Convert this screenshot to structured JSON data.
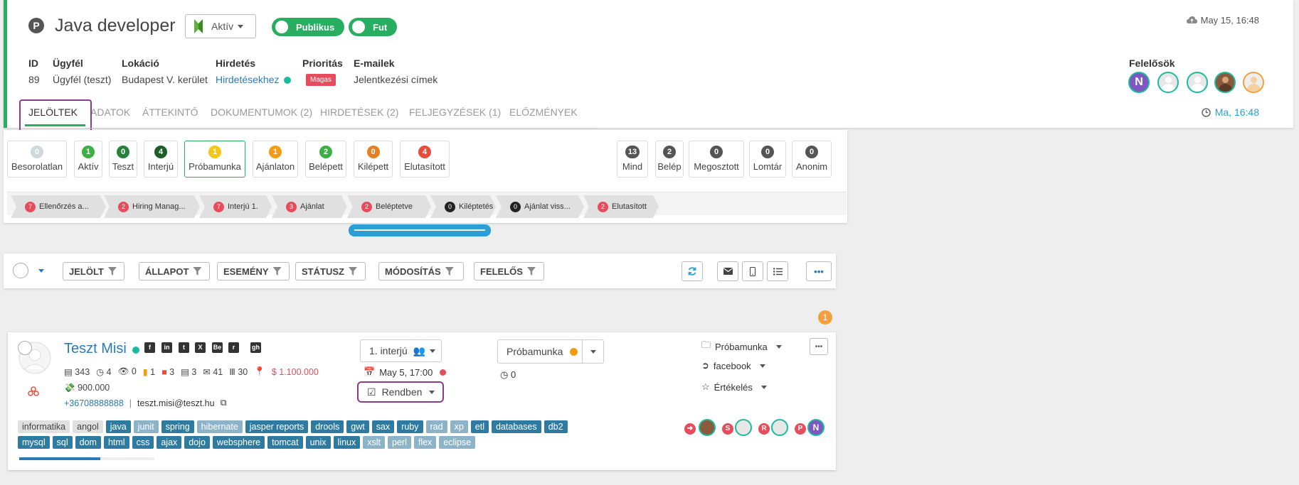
{
  "header": {
    "badge": "P",
    "title": "Java developer",
    "status": "Aktív",
    "toggle_public": "Publikus",
    "toggle_running": "Fut",
    "sync_time": "May 15, 16:48",
    "meta": {
      "id_label": "ID",
      "id_value": "89",
      "client_label": "Ügyfél",
      "client_value": "Ügyfél (teszt)",
      "location_label": "Lokáció",
      "location_value": "Budapest V. kerület",
      "ad_label": "Hirdetés",
      "ad_value": "Hirdetésekhez",
      "priority_label": "Prioritás",
      "priority_value": "Magas",
      "email_label": "E-mailek",
      "email_value": "Jelentkezési címek"
    },
    "responsibles_label": "Felelősök",
    "tabs": [
      "JELÖLTEK",
      "ADATOK",
      "ÁTTEKINTŐ",
      "DOKUMENTUMOK (2)",
      "HIRDETÉSEK (2)",
      "FELJEGYZÉSEK (1)",
      "ELŐZMÉNYEK"
    ],
    "last_time": "Ma, 16:48"
  },
  "status_counts": [
    {
      "label": "Besorolatlan",
      "count": "0",
      "color": "#cfd8dc"
    },
    {
      "label": "Aktív",
      "count": "1",
      "color": "#3cb043"
    },
    {
      "label": "Teszt",
      "count": "0",
      "color": "#27813a"
    },
    {
      "label": "Interjú",
      "count": "4",
      "color": "#1e5e2a"
    },
    {
      "label": "Próbamunka",
      "count": "1",
      "color": "#f5c518"
    },
    {
      "label": "Ajánlaton",
      "count": "1",
      "color": "#f39c12"
    },
    {
      "label": "Belépett",
      "count": "2",
      "color": "#3cb043"
    },
    {
      "label": "Kilépett",
      "count": "0",
      "color": "#e67e22"
    },
    {
      "label": "Elutasított",
      "count": "4",
      "color": "#e74c3c"
    }
  ],
  "status_counts_right": [
    {
      "label": "Mind",
      "count": "13"
    },
    {
      "label": "Belép",
      "count": "2"
    },
    {
      "label": "Megosztott",
      "count": "0"
    },
    {
      "label": "Lomtár",
      "count": "0"
    },
    {
      "label": "Anonim",
      "count": "0"
    }
  ],
  "pipeline": [
    {
      "count": "7",
      "label": "Ellenőrzés a..."
    },
    {
      "count": "2",
      "label": "Hiring Manag..."
    },
    {
      "count": "7",
      "label": "Interjú 1."
    },
    {
      "count": "3",
      "label": "Ajánlat"
    },
    {
      "count": "2",
      "label": "Beléptetve"
    },
    {
      "count": "0",
      "label": "Kiléptetés"
    },
    {
      "count": "0",
      "label": "Ajánlat viss..."
    },
    {
      "count": "2",
      "label": "Elutasított"
    }
  ],
  "filters": [
    "JELÖLT",
    "ÁLLAPOT",
    "ESEMÉNY",
    "STÁTUSZ",
    "MÓDOSÍTÁS",
    "FELELŐS"
  ],
  "notification_count": "1",
  "candidate": {
    "name": "Teszt Misi",
    "social": [
      "f",
      "in",
      "t",
      "X",
      "Be",
      "r",
      "gh"
    ],
    "stats": {
      "a": "343",
      "b": "4",
      "c": "0",
      "d": "1",
      "e": "3",
      "f": "3",
      "g": "41",
      "h": "30"
    },
    "salary": "1.100.000",
    "salary2": "900.000",
    "phone": "+36708888888",
    "separator": "|",
    "email": "teszt.misi@teszt.hu",
    "stage": "1. interjú",
    "date": "May 5, 17:00",
    "check": "Rendben",
    "status": "Próbamunka",
    "status_count": "0",
    "folder": "Próbamunka",
    "source": "facebook",
    "rating": "Értékelés",
    "letters": [
      "S",
      "R",
      "P"
    ],
    "avatar_n": "N",
    "tags_row1": [
      {
        "t": "informatika",
        "k": "grey"
      },
      {
        "t": "angol",
        "k": "grey"
      },
      {
        "t": "java",
        "k": "dark"
      },
      {
        "t": "junit",
        "k": "light"
      },
      {
        "t": "spring",
        "k": "dark"
      },
      {
        "t": "hibernate",
        "k": "light"
      },
      {
        "t": "jasper reports",
        "k": "dark"
      },
      {
        "t": "drools",
        "k": "dark"
      },
      {
        "t": "gwt",
        "k": "dark"
      },
      {
        "t": "sax",
        "k": "dark"
      },
      {
        "t": "ruby",
        "k": "dark"
      },
      {
        "t": "rad",
        "k": "light"
      },
      {
        "t": "xp",
        "k": "light"
      },
      {
        "t": "etl",
        "k": "dark"
      },
      {
        "t": "databases",
        "k": "dark"
      },
      {
        "t": "db2",
        "k": "dark"
      }
    ],
    "tags_row2": [
      {
        "t": "mysql",
        "k": "dark"
      },
      {
        "t": "sql",
        "k": "dark"
      },
      {
        "t": "dom",
        "k": "dark"
      },
      {
        "t": "html",
        "k": "dark"
      },
      {
        "t": "css",
        "k": "dark"
      },
      {
        "t": "ajax",
        "k": "dark"
      },
      {
        "t": "dojo",
        "k": "dark"
      },
      {
        "t": "websphere",
        "k": "dark"
      },
      {
        "t": "tomcat",
        "k": "dark"
      },
      {
        "t": "unix",
        "k": "dark"
      },
      {
        "t": "linux",
        "k": "dark"
      },
      {
        "t": "xslt",
        "k": "light"
      },
      {
        "t": "perl",
        "k": "light"
      },
      {
        "t": "flex",
        "k": "light"
      },
      {
        "t": "eclipse",
        "k": "light"
      }
    ],
    "profile_completion": 0.6
  }
}
